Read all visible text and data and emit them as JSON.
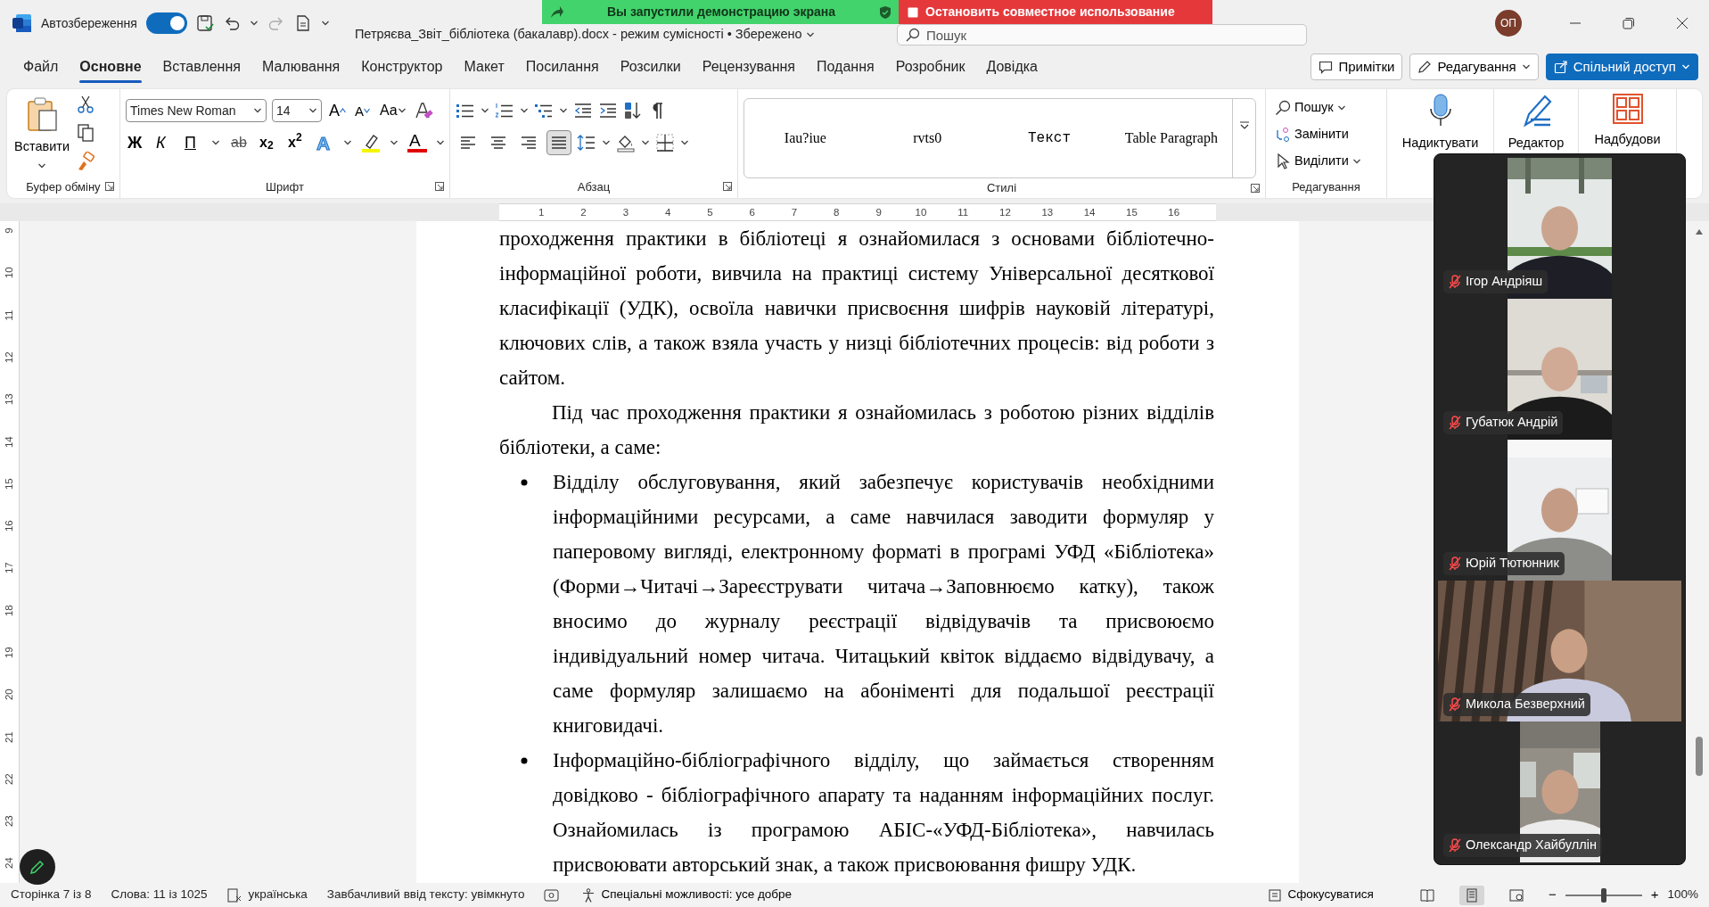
{
  "title_bar": {
    "autosave_label": "Автозбереження",
    "autosave_on": true,
    "document_title": "Петряєва_Звіт_бібліотека (бакалавр).docx  -  режим сумісності • Збережено",
    "search_placeholder": "Пошук",
    "user_initials": "ОП"
  },
  "screen_share": {
    "message": "Вы запустили демонстрацию экрана",
    "stop_label": "Остановить совместное использование"
  },
  "tabs": [
    {
      "label": "Файл",
      "selected": false
    },
    {
      "label": "Основне",
      "selected": true
    },
    {
      "label": "Вставлення",
      "selected": false
    },
    {
      "label": "Малювання",
      "selected": false
    },
    {
      "label": "Конструктор",
      "selected": false
    },
    {
      "label": "Макет",
      "selected": false
    },
    {
      "label": "Посилання",
      "selected": false
    },
    {
      "label": "Розсилки",
      "selected": false
    },
    {
      "label": "Рецензування",
      "selected": false
    },
    {
      "label": "Подання",
      "selected": false
    },
    {
      "label": "Розробник",
      "selected": false
    },
    {
      "label": "Довідка",
      "selected": false
    }
  ],
  "tab_actions": [
    {
      "label": "Примітки",
      "kind": "comments"
    },
    {
      "label": "Редагування",
      "kind": "editing"
    },
    {
      "label": "Спільний доступ",
      "kind": "share"
    }
  ],
  "ribbon": {
    "clipboard": {
      "paste_label": "Вставити",
      "group_label": "Буфер обміну"
    },
    "font": {
      "font_name": "Times New Roman",
      "font_size": "14",
      "grow_label": "A",
      "shrink_label": "A",
      "case_label": "Aa",
      "format_buttons": [
        "Ж",
        "К",
        "П"
      ],
      "strike_label": "ab",
      "subscript_label": "x$_{2}$",
      "superscript_label": "x$^{2}$",
      "effects_label": "A",
      "font_color_label": "A",
      "group_label": "Шрифт"
    },
    "paragraph": {
      "alignments": [
        {
          "kind": "left",
          "selected": false
        },
        {
          "kind": "center",
          "selected": false
        },
        {
          "kind": "right",
          "selected": false
        },
        {
          "kind": "justify",
          "selected": true
        }
      ],
      "group_label": "Абзац"
    },
    "styles": {
      "items": [
        "Iau?iue",
        "rvts0",
        "Текст",
        "Table Paragraph"
      ],
      "group_label": "Стилі"
    },
    "editing": {
      "items": [
        {
          "label": "Пошук",
          "kind": "find"
        },
        {
          "label": "Замінити",
          "kind": "replace"
        },
        {
          "label": "Виділити",
          "kind": "select"
        }
      ],
      "group_label": "Редагування"
    },
    "large_buttons": [
      {
        "label": "Надиктувати",
        "kind": "dictate"
      },
      {
        "label": "Редактор",
        "kind": "editor"
      },
      {
        "label": "Надбудови",
        "kind": "addins"
      }
    ]
  },
  "horizontal_ruler": [
    "1",
    "2",
    "3",
    "4",
    "5",
    "6",
    "7",
    "8",
    "9",
    "10",
    "11",
    "12",
    "13",
    "14",
    "15",
    "16"
  ],
  "vertical_ruler": [
    "9",
    "10",
    "11",
    "12",
    "13",
    "14",
    "15",
    "16",
    "17",
    "18",
    "19",
    "20",
    "21",
    "22",
    "23",
    "24"
  ],
  "document": {
    "paragraphs": [
      {
        "kind": "continuation",
        "text": "проходження практики в бібліотеці я ознайомилася з основами бібліотечно-інформаційної роботи, вивчила на практиці систему Універсальної десяткової класифікації (УДК), освоїла навички присвоєння шифрів науковій літературі, ключових слів, а також взяла участь у низці бібліотечних процесів: від роботи з сайтом."
      },
      {
        "kind": "indented",
        "text": "Під час проходження практики я ознайомилась з роботою різних відділів бібліотеки, а саме:"
      },
      {
        "kind": "bullet",
        "text": "Відділу обслуговування, який забезпечує користувачів необхідними інформаційними ресурсами, а саме навчилася заводити формуляр у паперовому вигляді, електронному форматі в програмі УФД «Бібліотека» (Форми→Читачі→Зареєструвати читача→Заповнюємо катку), також вносимо до журналу реєстрації відвідувачів та присвоюємо індивідуальний номер читача. Читацький квіток віддаємо відвідувачу, а саме формуляр залишаємо на абоніменті для подальшої реєстрації книговидачі."
      },
      {
        "kind": "bullet",
        "text": "Інформаційно-бібліографічного відділу, що займається створенням довідково - бібліографічного апарату та наданням інформаційних послуг. Ознайомилась із програмою АБІС-«УФД-Бібліотека», навчилась присвоювати авторський знак, а також присвоювання фишру УДК."
      }
    ]
  },
  "meeting_panel": {
    "participants": [
      {
        "name": "Ігор Андріяш",
        "muted": true,
        "kind": "portrait"
      },
      {
        "name": "Губатюк Андрій",
        "muted": true,
        "kind": "portrait"
      },
      {
        "name": "Юрій Тютюнник",
        "muted": true,
        "kind": "portrait"
      },
      {
        "name": "Микола Безверхний",
        "muted": true,
        "kind": "wide"
      },
      {
        "name": "Олександр Хайбуллін",
        "muted": true,
        "kind": "narrow"
      }
    ]
  },
  "status_bar": {
    "page": "Сторінка 7 із 8",
    "words": "Слова: 11 із 1025",
    "language": "українська",
    "predictive_text": "Завбачливий ввід тексту: увімкнуто",
    "accessibility": "Спеціальні можливості: усе добре",
    "focus": "Сфокусуватися",
    "views": [
      {
        "kind": "read",
        "selected": false
      },
      {
        "kind": "print",
        "selected": true
      },
      {
        "kind": "web",
        "selected": false
      }
    ],
    "zoom_out": "−",
    "zoom_in": "+",
    "zoom": {
      "level": 0.5,
      "reading": "100%"
    }
  }
}
